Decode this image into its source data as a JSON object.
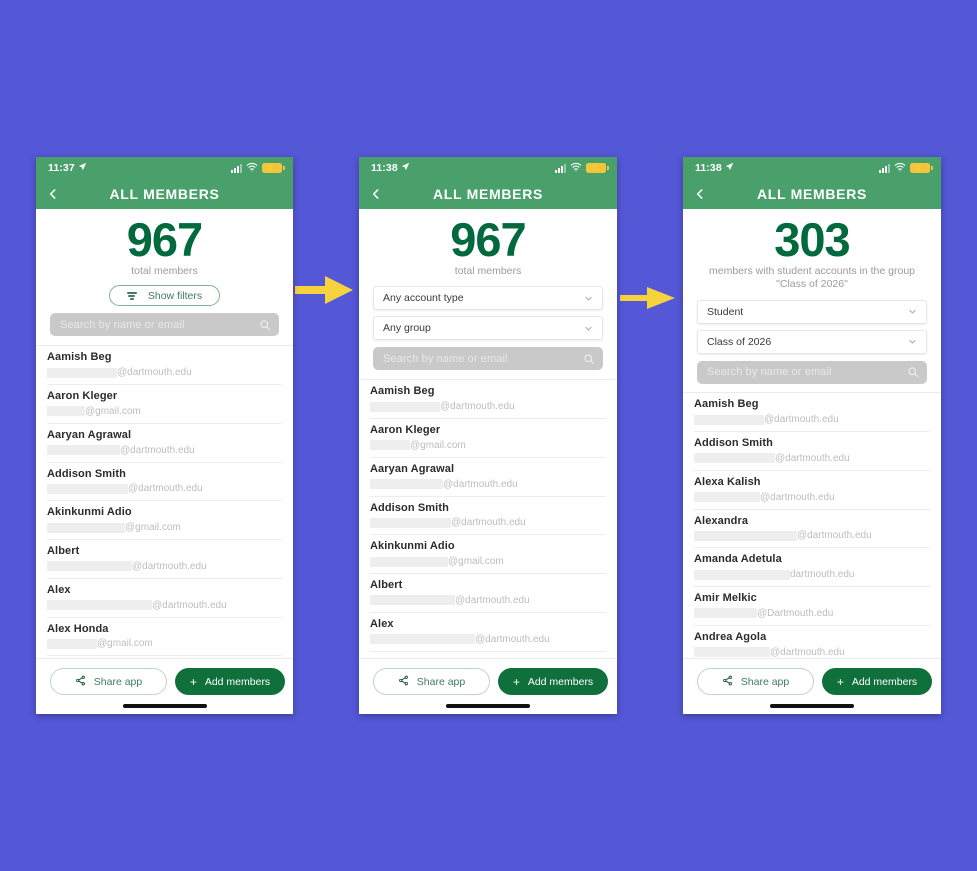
{
  "background_color": "#5457d6",
  "accent": {
    "header_green": "#4aa06b",
    "dark_green": "#00693e",
    "button_green": "#10703c",
    "arrow_yellow": "#f6d33c"
  },
  "shared": {
    "nav_title": "ALL MEMBERS",
    "back_icon": "chevron-left-icon",
    "search_placeholder": "Search by name or email",
    "search_icon": "search-icon",
    "share_label": "Share app",
    "share_icon": "share-icon",
    "add_label": "Add members",
    "add_icon": "plus-icon",
    "status_icons": {
      "signal": "signal-bars-icon",
      "wifi": "wifi-icon",
      "battery": "battery-charging-icon",
      "location": "location-arrow-icon"
    }
  },
  "phones": [
    {
      "id": "phone-1",
      "status_time": "11:37",
      "count": "967",
      "caption": "total members",
      "show_filters_label": "Show filters",
      "has_filters_button": true,
      "selects": [],
      "members": [
        {
          "name": "Aamish Beg",
          "redact_w": 70,
          "domain": "@dartmouth.edu"
        },
        {
          "name": "Aaron Kleger",
          "redact_w": 38,
          "domain": "@gmail.com"
        },
        {
          "name": "Aaryan Agrawal",
          "redact_w": 73,
          "domain": "@dartmouth.edu"
        },
        {
          "name": "Addison Smith",
          "redact_w": 81,
          "domain": "@dartmouth.edu"
        },
        {
          "name": "Akinkunmi Adio",
          "redact_w": 78,
          "domain": "@gmail.com"
        },
        {
          "name": "Albert",
          "redact_w": 85,
          "domain": "@dartmouth.edu"
        },
        {
          "name": "Alex",
          "redact_w": 105,
          "domain": "@dartmouth.edu"
        },
        {
          "name": "Alex Honda",
          "redact_w": 50,
          "domain": "@gmail.com"
        }
      ]
    },
    {
      "id": "phone-2",
      "status_time": "11:38",
      "count": "967",
      "caption": "total members",
      "has_filters_button": false,
      "selects": [
        {
          "value": "Any account type",
          "name": "account-type-select"
        },
        {
          "value": "Any group",
          "name": "group-select"
        }
      ],
      "members": [
        {
          "name": "Aamish Beg",
          "redact_w": 70,
          "domain": "@dartmouth.edu"
        },
        {
          "name": "Aaron Kleger",
          "redact_w": 40,
          "domain": "@gmail.com"
        },
        {
          "name": "Aaryan Agrawal",
          "redact_w": 73,
          "domain": "@dartmouth.edu"
        },
        {
          "name": "Addison Smith",
          "redact_w": 81,
          "domain": "@dartmouth.edu"
        },
        {
          "name": "Akinkunmi Adio",
          "redact_w": 78,
          "domain": "@gmail.com"
        },
        {
          "name": "Albert",
          "redact_w": 85,
          "domain": "@dartmouth.edu"
        },
        {
          "name": "Alex",
          "redact_w": 105,
          "domain": "@dartmouth.edu"
        }
      ]
    },
    {
      "id": "phone-3",
      "status_time": "11:38",
      "count": "303",
      "caption": "members with student accounts in the group \"Class of 2026\"",
      "has_filters_button": false,
      "selects": [
        {
          "value": "Student",
          "name": "account-type-select"
        },
        {
          "value": "Class of 2026",
          "name": "group-select"
        }
      ],
      "members": [
        {
          "name": "Aamish Beg",
          "redact_w": 70,
          "domain": "@dartmouth.edu"
        },
        {
          "name": "Addison Smith",
          "redact_w": 81,
          "domain": "@dartmouth.edu"
        },
        {
          "name": "Alexa Kalish",
          "redact_w": 66,
          "domain": "@dartmouth.edu"
        },
        {
          "name": "Alexandra",
          "redact_w": 103,
          "domain": "@dartmouth.edu"
        },
        {
          "name": "Amanda Adetula",
          "redact_w": 96,
          "domain": "dartmouth.edu"
        },
        {
          "name": "Amir Melkic",
          "redact_w": 63,
          "domain": "@Dartmouth.edu"
        },
        {
          "name": "Andrea Agola",
          "redact_w": 76,
          "domain": "@dartmouth.edu"
        }
      ]
    }
  ],
  "arrows": [
    {
      "name": "flow-arrow-1",
      "from": "phone-1",
      "to": "phone-2"
    },
    {
      "name": "flow-arrow-2",
      "from": "phone-2",
      "to": "phone-3"
    }
  ]
}
